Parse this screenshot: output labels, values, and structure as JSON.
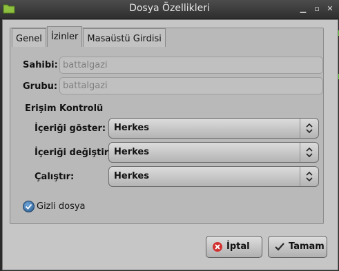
{
  "window": {
    "title": "Dosya Özellikleri"
  },
  "tabs": [
    {
      "label": "Genel",
      "active": false
    },
    {
      "label": "İzinler",
      "active": true
    },
    {
      "label": "Masaüstü Girdisi",
      "active": false
    }
  ],
  "owner": {
    "label": "Sahibi:",
    "value": "battalgazi"
  },
  "group": {
    "label": "Grubu:",
    "value": "battalgazi"
  },
  "access": {
    "heading": "Erişim Kontrolü",
    "view": {
      "label": "İçeriği göster:",
      "value": "Herkes"
    },
    "modify": {
      "label": "İçeriği değiştir:",
      "value": "Herkes"
    },
    "execute": {
      "label": "Çalıştır:",
      "value": "Herkes"
    }
  },
  "hidden": {
    "label": "Gizli dosya",
    "checked": true
  },
  "buttons": {
    "cancel": "İptal",
    "ok": "Tamam"
  },
  "colors": {
    "accent_check": "#2e6aa6",
    "cancel_icon": "#d23030",
    "ok_check": "#2a2a2a"
  }
}
